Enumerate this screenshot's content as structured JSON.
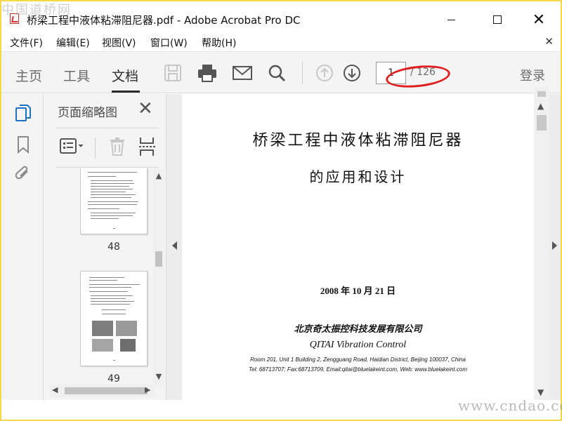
{
  "watermark_top": "中国道桥网",
  "watermark_bottom": "www.cndao.com",
  "window": {
    "title": "桥梁工程中液体粘滞阻尼器.pdf - Adobe Acrobat Pro DC",
    "minimize_icon": "minimize-icon",
    "maximize_icon": "maximize-icon",
    "close_glyph": "✕"
  },
  "menu": {
    "items": [
      "文件(F)",
      "编辑(E)",
      "视图(V)",
      "窗口(W)",
      "帮助(H)"
    ],
    "close_glyph": "✕"
  },
  "toolbar": {
    "tabs": [
      "主页",
      "工具",
      "文档"
    ],
    "active_tab": "文档",
    "page_current": "1",
    "page_total": "/ 126",
    "login": "登录",
    "icons": [
      "save-icon",
      "print-icon",
      "email-icon",
      "search-icon",
      "prev-page-icon",
      "next-page-icon"
    ]
  },
  "left_strip": {
    "icons": [
      "page-thumbnails-icon",
      "bookmark-icon",
      "attachment-icon"
    ]
  },
  "thumb_panel": {
    "title": "页面缩略图",
    "close_glyph": "✕",
    "tools": [
      "options-menu-icon",
      "delete-page-icon",
      "split-page-icon"
    ],
    "pages": [
      {
        "label": "48"
      },
      {
        "label": "49"
      }
    ]
  },
  "document": {
    "title_line1": "桥梁工程中液体粘滞阻尼器",
    "title_line2": "的应用和设计",
    "date": "2008 年 10 月 21 日",
    "company_cn": "北京奇太振控科技发展有限公司",
    "company_en": "QITAI Vibration Control",
    "address": "Room 201, Unit 1 Building 2,  Zengguang Road, Haidian District, Beijing 100037, China",
    "contact": "Tel: 68713707; Fax:68713709,     Email:qitai@bluelakeint.com, Web: www.bluelakeint.com"
  },
  "colors": {
    "frame": "#f5d94a",
    "accent_blue": "#1a73c8",
    "highlight_red": "#e02020"
  }
}
